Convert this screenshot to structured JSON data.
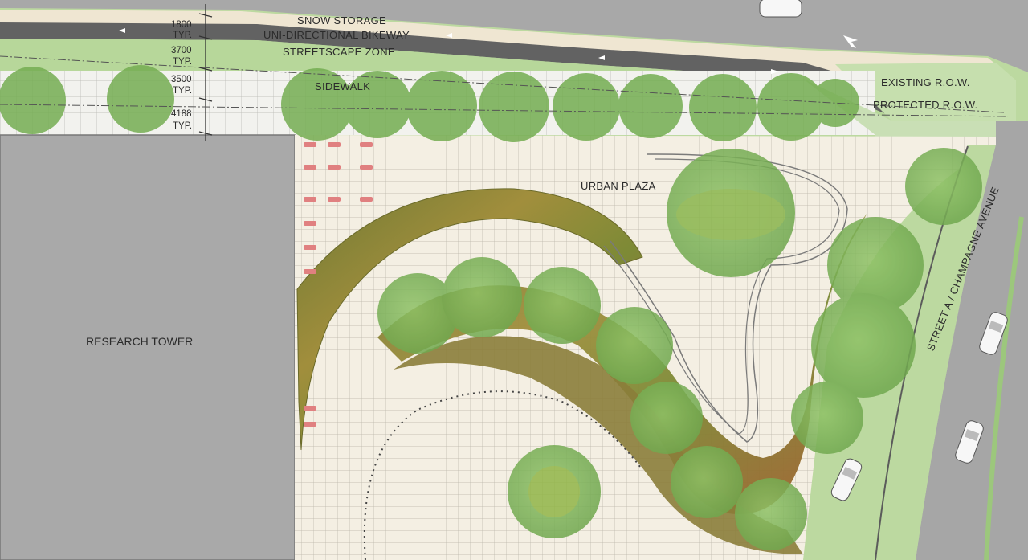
{
  "plan_labels": {
    "snow_storage": "SNOW STORAGE",
    "bikeway": "UNI-DIRECTIONAL BIKEWAY",
    "streetscape": "STREETSCAPE ZONE",
    "sidewalk": "SIDEWALK",
    "urban_plaza": "URBAN PLAZA",
    "research_tower": "RESEARCH TOWER",
    "street": "STREET A / CHAMPAGNE AVENUE",
    "existing_row": "EXISTING R.O.W.",
    "protected_row": "PROTECTED R.O.W."
  },
  "dimensions": [
    {
      "value": "1800",
      "unit": "TYP."
    },
    {
      "value": "3700",
      "unit": "TYP."
    },
    {
      "value": "3500",
      "unit": "TYP."
    },
    {
      "value": "4188",
      "unit": "TYP."
    }
  ],
  "colors": {
    "road": "#a6a6a6",
    "building": "#a9a9a9",
    "grass": "#b7d79a",
    "paving": "#f3ede0",
    "tree": "#7fb35c",
    "planting": "#8d8c3c",
    "bikeway": "#5e5e5e"
  }
}
